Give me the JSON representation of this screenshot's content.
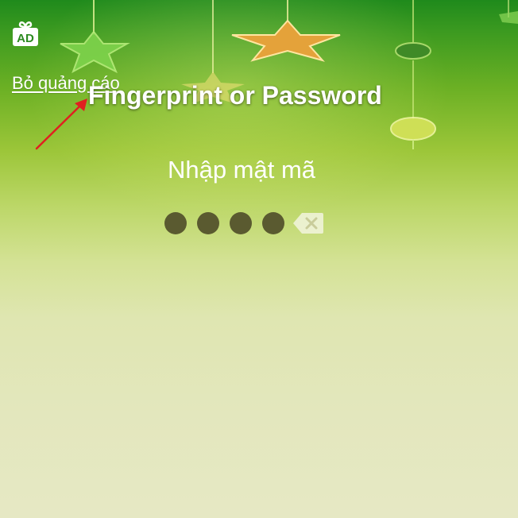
{
  "header": {
    "ad_badge_icon": "ad-gift-icon",
    "remove_ads_label": "Bỏ quảng cáo"
  },
  "lock_screen": {
    "title": "Fingerprint or Password",
    "prompt": "Nhập mật mã",
    "entered_digit_count": 4,
    "backspace_icon": "backspace-icon"
  },
  "annotation": {
    "arrow_icon": "red-arrow-icon",
    "arrow_color": "#e02020"
  },
  "colors": {
    "dot": "#5a5a30",
    "background_top": "#1f8a1c",
    "background_bottom": "#e6e8c4"
  }
}
